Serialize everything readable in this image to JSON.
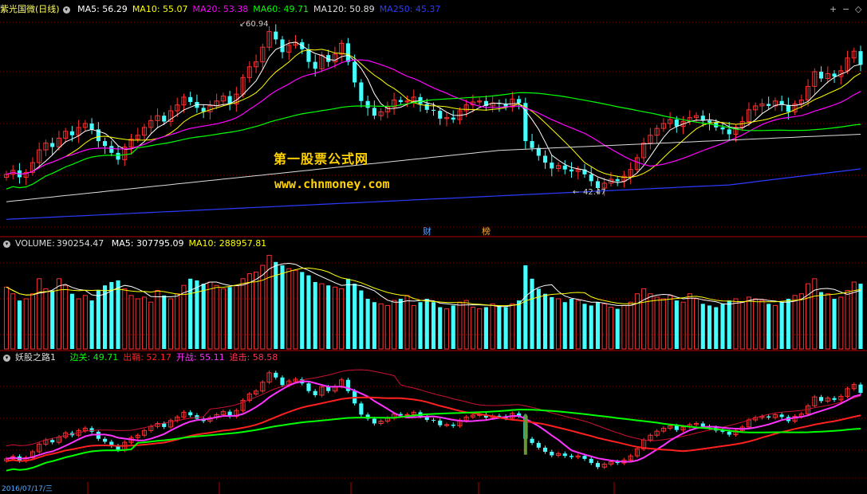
{
  "window": {
    "title": "紫光国微(日线)"
  },
  "panels": {
    "price": {
      "indicators": [
        {
          "label": "MA5:",
          "value": "56.29",
          "color": "#ffffff"
        },
        {
          "label": "MA10:",
          "value": "55.07",
          "color": "#ffff00"
        },
        {
          "label": "MA20:",
          "value": "53.38",
          "color": "#ff00ff"
        },
        {
          "label": "MA60:",
          "value": "49.71",
          "color": "#00ff00"
        },
        {
          "label": "MA120:",
          "value": "50.89",
          "color": "#dddddd"
        },
        {
          "label": "MA250:",
          "value": "45.37",
          "color": "#2b3cff"
        }
      ],
      "high_label": "60.94",
      "low_label": "42.47",
      "badges": [
        {
          "text": "财",
          "color": "#5aa0ff"
        },
        {
          "text": "榜",
          "color": "#ffaa33"
        }
      ]
    },
    "volume": {
      "title": "VOLUME:",
      "title_value": "390254.47",
      "indicators": [
        {
          "label": "MA5:",
          "value": "307795.09",
          "color": "#ffffff"
        },
        {
          "label": "MA10:",
          "value": "288957.81",
          "color": "#ffff00"
        }
      ]
    },
    "indicator": {
      "title": "妖股之路1",
      "indicators": [
        {
          "label": "边关:",
          "value": "49.71",
          "color": "#00ff00"
        },
        {
          "label": "出鞘:",
          "value": "52.17",
          "color": "#ff2020"
        },
        {
          "label": "开战:",
          "value": "55.11",
          "color": "#ff33ff"
        },
        {
          "label": "追击:",
          "value": "58.58",
          "color": "#ff3355"
        }
      ]
    }
  },
  "watermark": {
    "line1": "第一股票公式网",
    "line2": "www.chnmoney.com"
  },
  "controls": {
    "zoom_in": "+",
    "zoom_out": "−",
    "pin": "◇"
  },
  "date_label": "2016/07/17/三",
  "colors": {
    "up": "#ff3030",
    "down": "#44ffff",
    "grid": "#7a0000",
    "ma5": "#ffffff",
    "ma10": "#ffff00",
    "ma20": "#ff00ff",
    "ma60": "#00ff00",
    "ma120": "#dddddd",
    "ma250": "#2b3cff"
  },
  "chart_data": {
    "type": "candlestick",
    "symbol": "紫光国微",
    "period": "日线",
    "ylim": [
      40,
      62
    ],
    "closes": [
      45.8,
      46.2,
      45.5,
      46.0,
      47.0,
      48.3,
      49.0,
      48.6,
      49.5,
      50.2,
      49.8,
      50.6,
      51.0,
      50.4,
      49.2,
      48.7,
      48.0,
      47.3,
      48.6,
      49.4,
      49.8,
      50.6,
      51.3,
      51.8,
      51.2,
      52.3,
      52.9,
      53.7,
      53.2,
      52.6,
      52.2,
      52.8,
      53.3,
      53.8,
      53.0,
      54.0,
      55.7,
      56.8,
      57.3,
      58.8,
      60.4,
      59.6,
      58.3,
      59.0,
      59.3,
      58.6,
      57.3,
      56.6,
      58.0,
      57.3,
      58.1,
      59.2,
      57.3,
      55.2,
      53.3,
      52.6,
      51.8,
      52.2,
      52.7,
      53.4,
      53.2,
      53.3,
      53.7,
      53.0,
      52.4,
      52.3,
      51.5,
      51.6,
      51.4,
      52.3,
      52.9,
      53.2,
      53.3,
      52.8,
      53.1,
      53.0,
      52.7,
      53.5,
      53.1,
      49.2,
      48.5,
      47.7,
      47.0,
      46.4,
      46.7,
      46.3,
      46.1,
      46.3,
      45.8,
      45.1,
      44.4,
      44.9,
      45.3,
      45.1,
      45.6,
      46.3,
      47.5,
      49.0,
      49.8,
      50.5,
      51.0,
      51.4,
      50.7,
      51.2,
      51.6,
      51.8,
      51.3,
      51.1,
      50.6,
      50.4,
      49.9,
      50.6,
      51.2,
      52.4,
      52.8,
      53.0,
      52.8,
      53.3,
      52.9,
      52.2,
      53.0,
      53.4,
      54.8,
      56.3,
      55.6,
      56.1,
      55.8,
      56.4,
      57.7,
      58.4,
      57.0
    ],
    "volumes": [
      370000,
      330000,
      290000,
      300000,
      330000,
      420000,
      360000,
      350000,
      420000,
      380000,
      330000,
      300000,
      320000,
      290000,
      350000,
      380000,
      400000,
      410000,
      360000,
      320000,
      300000,
      310000,
      280000,
      350000,
      320000,
      300000,
      330000,
      380000,
      420000,
      410000,
      390000,
      400000,
      380000,
      360000,
      370000,
      380000,
      420000,
      450000,
      460000,
      500000,
      560000,
      520000,
      500000,
      480000,
      470000,
      460000,
      440000,
      400000,
      390000,
      380000,
      370000,
      360000,
      420000,
      390000,
      350000,
      300000,
      280000,
      270000,
      260000,
      290000,
      300000,
      320000,
      260000,
      280000,
      300000,
      280000,
      250000,
      240000,
      260000,
      280000,
      290000,
      250000,
      240000,
      250000,
      270000,
      260000,
      250000,
      270000,
      290000,
      500000,
      420000,
      360000,
      330000,
      310000,
      300000,
      280000,
      300000,
      290000,
      270000,
      260000,
      280000,
      270000,
      250000,
      240000,
      260000,
      280000,
      330000,
      360000,
      330000,
      310000,
      300000,
      320000,
      290000,
      280000,
      330000,
      300000,
      270000,
      260000,
      250000,
      270000,
      290000,
      300000,
      280000,
      310000,
      300000,
      290000,
      270000,
      260000,
      280000,
      300000,
      320000,
      330000,
      390000,
      420000,
      340000,
      330000,
      300000,
      310000,
      350000,
      400000,
      390254
    ]
  }
}
